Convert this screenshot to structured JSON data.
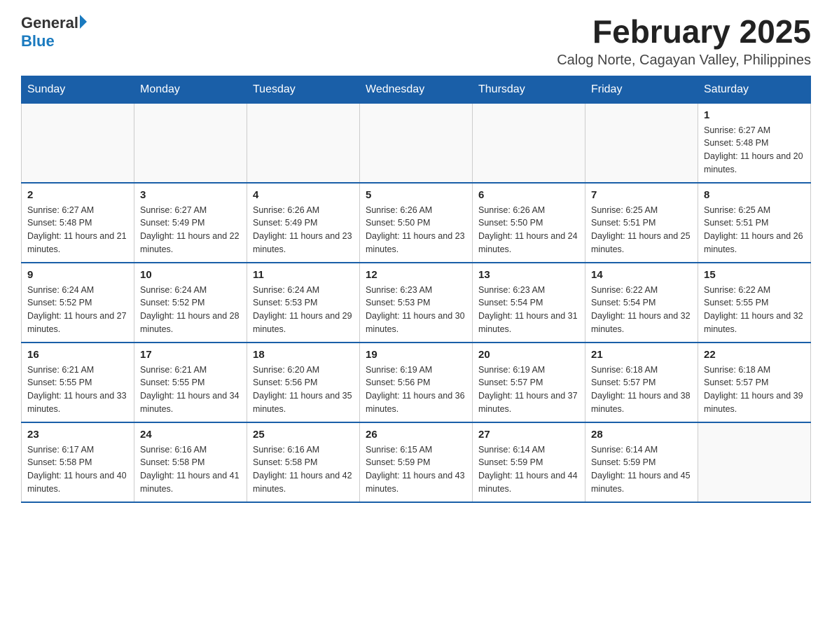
{
  "logo": {
    "general": "General",
    "blue": "Blue"
  },
  "title": "February 2025",
  "subtitle": "Calog Norte, Cagayan Valley, Philippines",
  "weekdays": [
    "Sunday",
    "Monday",
    "Tuesday",
    "Wednesday",
    "Thursday",
    "Friday",
    "Saturday"
  ],
  "weeks": [
    [
      {
        "day": "",
        "info": ""
      },
      {
        "day": "",
        "info": ""
      },
      {
        "day": "",
        "info": ""
      },
      {
        "day": "",
        "info": ""
      },
      {
        "day": "",
        "info": ""
      },
      {
        "day": "",
        "info": ""
      },
      {
        "day": "1",
        "info": "Sunrise: 6:27 AM\nSunset: 5:48 PM\nDaylight: 11 hours and 20 minutes."
      }
    ],
    [
      {
        "day": "2",
        "info": "Sunrise: 6:27 AM\nSunset: 5:48 PM\nDaylight: 11 hours and 21 minutes."
      },
      {
        "day": "3",
        "info": "Sunrise: 6:27 AM\nSunset: 5:49 PM\nDaylight: 11 hours and 22 minutes."
      },
      {
        "day": "4",
        "info": "Sunrise: 6:26 AM\nSunset: 5:49 PM\nDaylight: 11 hours and 23 minutes."
      },
      {
        "day": "5",
        "info": "Sunrise: 6:26 AM\nSunset: 5:50 PM\nDaylight: 11 hours and 23 minutes."
      },
      {
        "day": "6",
        "info": "Sunrise: 6:26 AM\nSunset: 5:50 PM\nDaylight: 11 hours and 24 minutes."
      },
      {
        "day": "7",
        "info": "Sunrise: 6:25 AM\nSunset: 5:51 PM\nDaylight: 11 hours and 25 minutes."
      },
      {
        "day": "8",
        "info": "Sunrise: 6:25 AM\nSunset: 5:51 PM\nDaylight: 11 hours and 26 minutes."
      }
    ],
    [
      {
        "day": "9",
        "info": "Sunrise: 6:24 AM\nSunset: 5:52 PM\nDaylight: 11 hours and 27 minutes."
      },
      {
        "day": "10",
        "info": "Sunrise: 6:24 AM\nSunset: 5:52 PM\nDaylight: 11 hours and 28 minutes."
      },
      {
        "day": "11",
        "info": "Sunrise: 6:24 AM\nSunset: 5:53 PM\nDaylight: 11 hours and 29 minutes."
      },
      {
        "day": "12",
        "info": "Sunrise: 6:23 AM\nSunset: 5:53 PM\nDaylight: 11 hours and 30 minutes."
      },
      {
        "day": "13",
        "info": "Sunrise: 6:23 AM\nSunset: 5:54 PM\nDaylight: 11 hours and 31 minutes."
      },
      {
        "day": "14",
        "info": "Sunrise: 6:22 AM\nSunset: 5:54 PM\nDaylight: 11 hours and 32 minutes."
      },
      {
        "day": "15",
        "info": "Sunrise: 6:22 AM\nSunset: 5:55 PM\nDaylight: 11 hours and 32 minutes."
      }
    ],
    [
      {
        "day": "16",
        "info": "Sunrise: 6:21 AM\nSunset: 5:55 PM\nDaylight: 11 hours and 33 minutes."
      },
      {
        "day": "17",
        "info": "Sunrise: 6:21 AM\nSunset: 5:55 PM\nDaylight: 11 hours and 34 minutes."
      },
      {
        "day": "18",
        "info": "Sunrise: 6:20 AM\nSunset: 5:56 PM\nDaylight: 11 hours and 35 minutes."
      },
      {
        "day": "19",
        "info": "Sunrise: 6:19 AM\nSunset: 5:56 PM\nDaylight: 11 hours and 36 minutes."
      },
      {
        "day": "20",
        "info": "Sunrise: 6:19 AM\nSunset: 5:57 PM\nDaylight: 11 hours and 37 minutes."
      },
      {
        "day": "21",
        "info": "Sunrise: 6:18 AM\nSunset: 5:57 PM\nDaylight: 11 hours and 38 minutes."
      },
      {
        "day": "22",
        "info": "Sunrise: 6:18 AM\nSunset: 5:57 PM\nDaylight: 11 hours and 39 minutes."
      }
    ],
    [
      {
        "day": "23",
        "info": "Sunrise: 6:17 AM\nSunset: 5:58 PM\nDaylight: 11 hours and 40 minutes."
      },
      {
        "day": "24",
        "info": "Sunrise: 6:16 AM\nSunset: 5:58 PM\nDaylight: 11 hours and 41 minutes."
      },
      {
        "day": "25",
        "info": "Sunrise: 6:16 AM\nSunset: 5:58 PM\nDaylight: 11 hours and 42 minutes."
      },
      {
        "day": "26",
        "info": "Sunrise: 6:15 AM\nSunset: 5:59 PM\nDaylight: 11 hours and 43 minutes."
      },
      {
        "day": "27",
        "info": "Sunrise: 6:14 AM\nSunset: 5:59 PM\nDaylight: 11 hours and 44 minutes."
      },
      {
        "day": "28",
        "info": "Sunrise: 6:14 AM\nSunset: 5:59 PM\nDaylight: 11 hours and 45 minutes."
      },
      {
        "day": "",
        "info": ""
      }
    ]
  ]
}
